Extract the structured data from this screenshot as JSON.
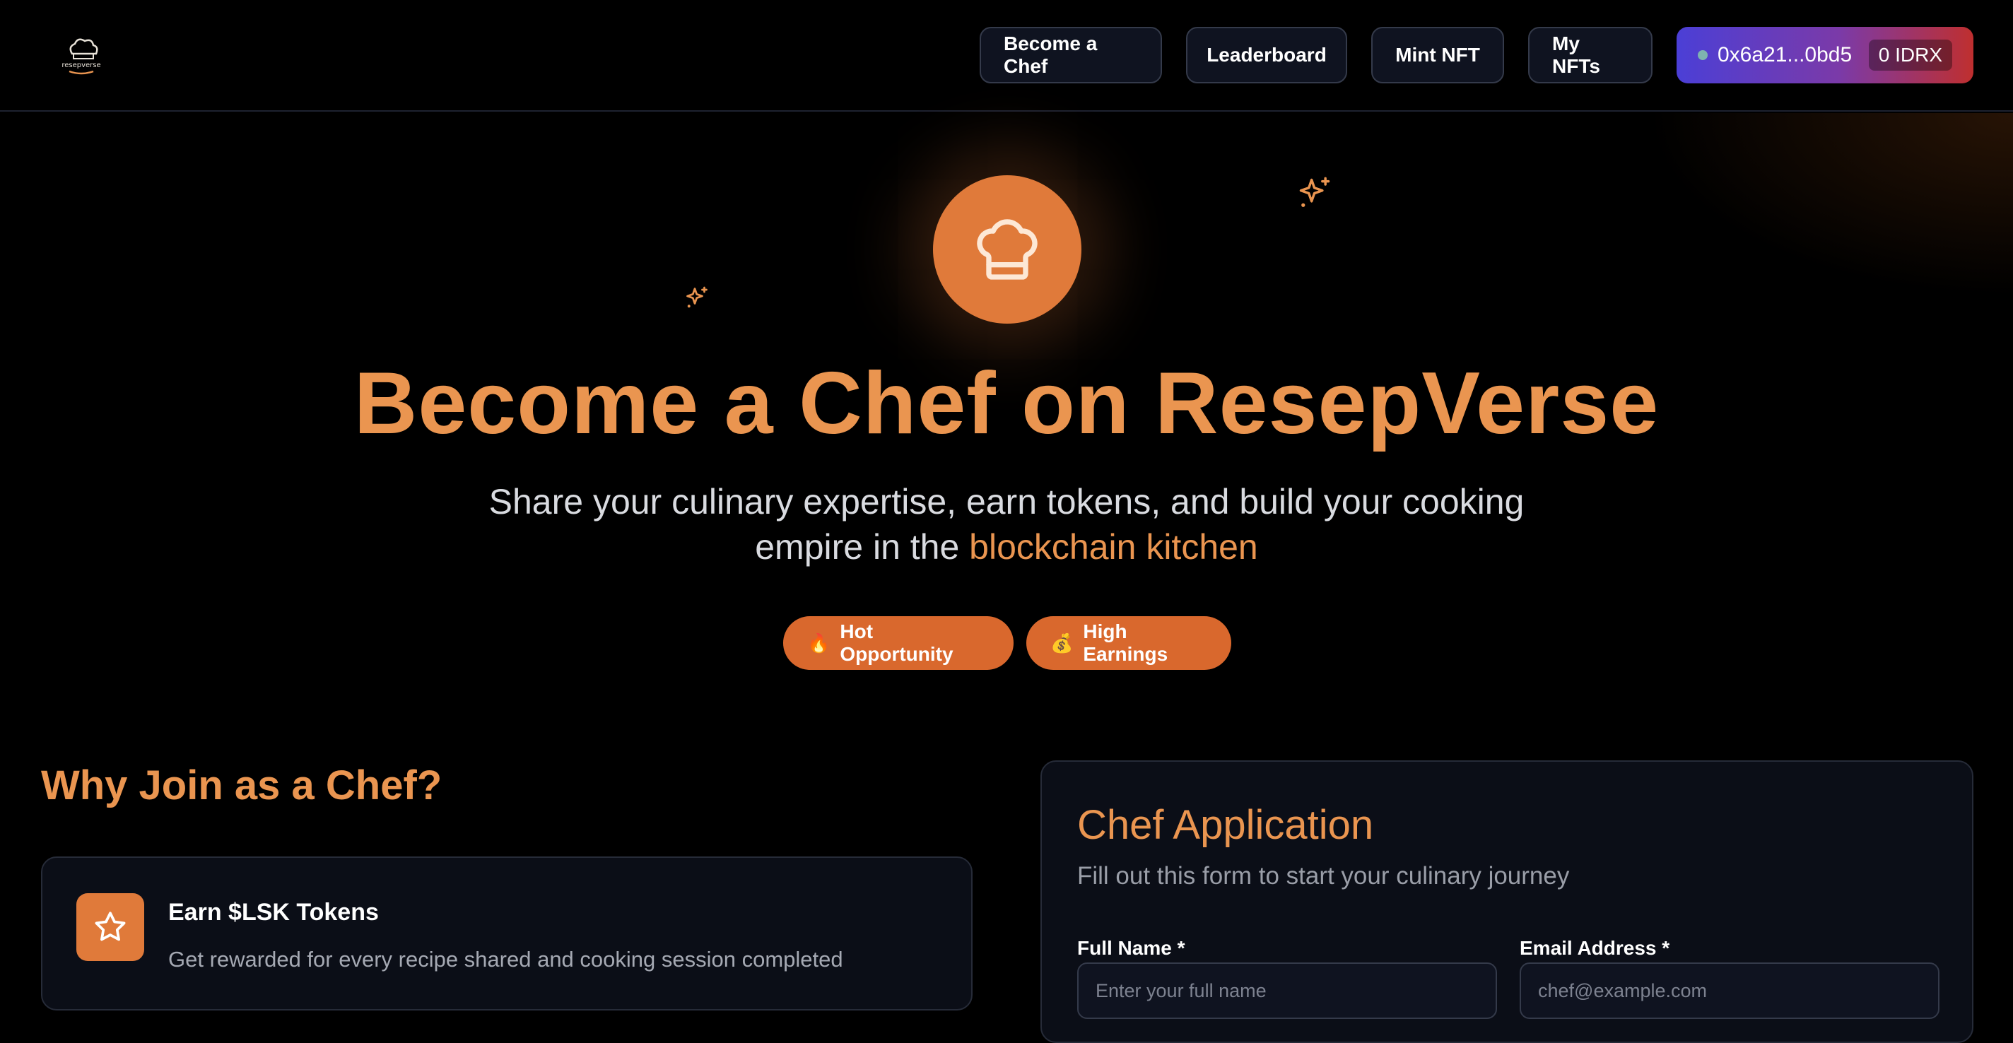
{
  "header": {
    "logo_text": "resepverse",
    "nav": [
      {
        "label": "Become a Chef"
      },
      {
        "label": "Leaderboard"
      },
      {
        "label": "Mint NFT"
      },
      {
        "label": "My NFTs"
      }
    ],
    "wallet": {
      "address": "0x6a21...0bd5",
      "balance": "0 IDRX"
    }
  },
  "hero": {
    "icon": "chef-hat-icon",
    "title": "Become a Chef on ResepVerse",
    "subtitle_pre": "Share your culinary expertise, earn tokens, and build your cooking empire in the ",
    "subtitle_highlight": "blockchain kitchen",
    "pills": [
      {
        "emoji": "🔥",
        "label": "Hot Opportunity"
      },
      {
        "emoji": "💰",
        "label": "High Earnings"
      }
    ]
  },
  "why": {
    "title": "Why Join as a Chef?",
    "features": [
      {
        "icon": "star-icon",
        "title": "Earn $LSK Tokens",
        "desc": "Get rewarded for every recipe shared and cooking session completed"
      }
    ]
  },
  "application": {
    "title": "Chef Application",
    "subtitle": "Fill out this form to start your culinary journey",
    "fields": [
      {
        "label": "Full Name *",
        "placeholder": "Enter your full name"
      },
      {
        "label": "Email Address *",
        "placeholder": "chef@example.com"
      }
    ]
  },
  "colors": {
    "accent": "#ea9550",
    "pill": "#d9682d",
    "wallet_gradient_start": "#4b3fd6",
    "wallet_gradient_end": "#bf2f2f",
    "card_bg": "#0b0e17"
  }
}
